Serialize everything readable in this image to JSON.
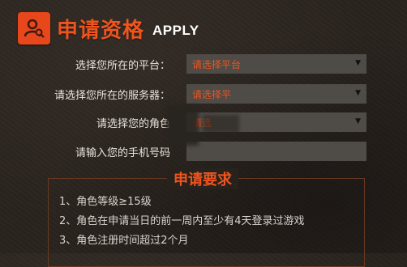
{
  "header": {
    "title": "申请资格",
    "subtitle": "APPLY",
    "icon": "user-search-icon"
  },
  "form": {
    "platform": {
      "label": "选择您所在的平台：",
      "value": "请选择平台"
    },
    "server": {
      "label": "请选择您所在的服务器：",
      "value": "请选择平"
    },
    "role": {
      "label": "请选择您的角色",
      "value": "请选"
    },
    "phone": {
      "label": "请输入您的手机号码",
      "value": ""
    }
  },
  "requirements": {
    "title": "申请要求",
    "items": [
      "1、角色等级≥15级",
      "2、角色在申请当日的前一周内至少有4天登录过游戏",
      "3、角色注册时间超过2个月"
    ]
  },
  "colors": {
    "accent": "#f0541e",
    "field_bg": "#4f4b47",
    "background": "#2a241f"
  }
}
